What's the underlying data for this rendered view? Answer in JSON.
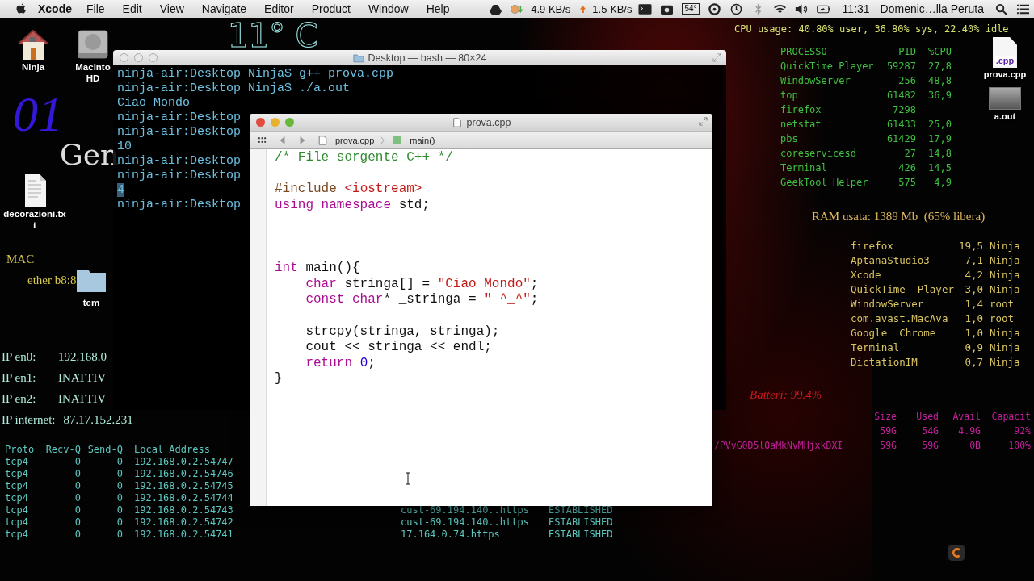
{
  "menu_bar": {
    "app": "Xcode",
    "menus": [
      "File",
      "Edit",
      "View",
      "Navigate",
      "Editor",
      "Product",
      "Window",
      "Help"
    ],
    "net_down": "4.9 KB/s",
    "net_up": "1.5 KB/s",
    "temperature": "54°",
    "clock": "11:31",
    "user": "Domenic…lla Peruta"
  },
  "clock_widget": {
    "temperature": "11° C",
    "day": "01",
    "month": "Gen"
  },
  "desktop_icons": [
    {
      "kind": "home",
      "label": "Ninja"
    },
    {
      "kind": "drive",
      "label": "Macinto HD"
    },
    {
      "kind": "text-file",
      "label": "decorazioni.txt"
    },
    {
      "kind": "folder",
      "label": "tem"
    }
  ],
  "desktop_files": [
    {
      "kind": "source-file",
      "badge": ".cpp",
      "label": "prova.cpp"
    },
    {
      "kind": "executable",
      "label": "a.out"
    }
  ],
  "mac_widget": {
    "title": "MAC",
    "ether": "ether b8:8"
  },
  "ip_widget": [
    {
      "label": "IP en0:",
      "value": "192.168.0"
    },
    {
      "label": "IP en1:",
      "value": "INATTIV"
    },
    {
      "label": "IP en2:",
      "value": "INATTIV"
    },
    {
      "label": "IP internet:",
      "value": "87.17.152.231"
    }
  ],
  "netstat": {
    "columns": [
      "Proto",
      "Recv-Q",
      "Send-Q",
      "Local Address"
    ],
    "rows": [
      {
        "proto": "tcp4",
        "recv": "0",
        "send": "0",
        "local": "192.168.0.2.54747"
      },
      {
        "proto": "tcp4",
        "recv": "0",
        "send": "0",
        "local": "192.168.0.2.54746"
      },
      {
        "proto": "tcp4",
        "recv": "0",
        "send": "0",
        "local": "192.168.0.2.54745"
      },
      {
        "proto": "tcp4",
        "recv": "0",
        "send": "0",
        "local": "192.168.0.2.54744"
      },
      {
        "proto": "tcp4",
        "recv": "0",
        "send": "0",
        "local": "192.168.0.2.54743",
        "foreign": "cust-69.194.140..https",
        "state": "ESTABLISHED"
      },
      {
        "proto": "tcp4",
        "recv": "0",
        "send": "0",
        "local": "192.168.0.2.54742",
        "foreign": "cust-69.194.140..https",
        "state": "ESTABLISHED"
      },
      {
        "proto": "tcp4",
        "recv": "0",
        "send": "0",
        "local": "192.168.0.2.54741",
        "foreign": "17.164.0.74.https",
        "state": "ESTABLISHED"
      }
    ]
  },
  "cpu_widget": {
    "summary": "CPU usage: 40.80% user, 36.80% sys, 22.40% idle",
    "columns": [
      "PROCESSO",
      "PID",
      "%CPU"
    ],
    "rows": [
      {
        "name": "QuickTime Player",
        "pid": "59287",
        "cpu": "27,8"
      },
      {
        "name": "WindowServer",
        "pid": "256",
        "cpu": "48,8"
      },
      {
        "name": "top",
        "pid": "61482",
        "cpu": "36,9"
      },
      {
        "name": "firefox",
        "pid": "7298"
      },
      {
        "name": "netstat",
        "pid": "61433",
        "cpu": "25,0"
      },
      {
        "name": "pbs",
        "pid": "61429",
        "cpu": "17,9"
      },
      {
        "name": "coreservicesd",
        "pid": "27",
        "cpu": "14,8"
      },
      {
        "name": "Terminal",
        "pid": "426",
        "cpu": "14,5"
      },
      {
        "name": "GeekTool Helper",
        "pid": "575",
        "cpu": "4,9"
      }
    ]
  },
  "ram_widget": {
    "summary": "RAM usata: 1389 Mb  (65% libera)",
    "rows": [
      {
        "name": "firefox",
        "mem": "19,5",
        "user": "Ninja"
      },
      {
        "name": "AptanaStudio3",
        "mem": "7,1",
        "user": "Ninja"
      },
      {
        "name": "Xcode",
        "mem": "4,2",
        "user": "Ninja"
      },
      {
        "name": "QuickTime  Player",
        "mem": "3,0",
        "user": "Ninja"
      },
      {
        "name": "WindowServer",
        "mem": "1,4",
        "user": "root"
      },
      {
        "name": "com.avast.MacAva",
        "mem": "1,0",
        "user": "root"
      },
      {
        "name": "Google  Chrome",
        "mem": "1,0",
        "user": "Ninja"
      },
      {
        "name": "Terminal",
        "mem": "0,9",
        "user": "Ninja"
      },
      {
        "name": "DictationIM",
        "mem": "0,7",
        "user": "Ninja"
      }
    ]
  },
  "battery_widget": {
    "text": "Batteri: 99.4%"
  },
  "disk_widget": {
    "columns": [
      "Size",
      "Used",
      "Avail",
      "Capacit"
    ],
    "rows": [
      {
        "values": [
          "59G",
          "54G",
          "4.9G",
          "92%"
        ]
      },
      {
        "name": "/PVvG0D5lOaMkNvMHjxkDXI",
        "values": [
          "59G",
          "59G",
          "0B",
          "100%"
        ]
      }
    ]
  },
  "terminal": {
    "title": "Desktop — bash — 80×24",
    "lines": [
      {
        "text": "ninja-air:Desktop Ninja$ g++ prova.cpp",
        "selected": false
      },
      {
        "text": "ninja-air:Desktop Ninja$ ./a.out",
        "selected": false
      },
      {
        "text": "Ciao Mondo",
        "selected": false
      },
      {
        "text": "ninja-air:Desktop",
        "selected": false
      },
      {
        "text": "ninja-air:Desktop",
        "selected": false
      },
      {
        "text": "10",
        "selected": false
      },
      {
        "text": "ninja-air:Desktop",
        "selected": false
      },
      {
        "text": "ninja-air:Desktop",
        "selected": false
      },
      {
        "text": "4",
        "selected": true
      },
      {
        "text": "ninja-air:Desktop",
        "selected": false
      }
    ]
  },
  "editor": {
    "title": "prova.cpp",
    "breadcrumb": [
      "prova.cpp",
      "main()"
    ],
    "lines": [
      {
        "kind": "code",
        "tokens": [
          {
            "text": "/* File sorgente C++ */",
            "kind": "comment"
          }
        ]
      },
      {
        "kind": "blank"
      },
      {
        "kind": "code",
        "tokens": [
          {
            "text": "#include ",
            "kind": "preproc"
          },
          {
            "text": "<iostream>",
            "kind": "string"
          }
        ]
      },
      {
        "kind": "code",
        "tokens": [
          {
            "text": "using namespace",
            "kind": "keyword"
          },
          {
            "text": " std;",
            "kind": "plain"
          }
        ]
      },
      {
        "kind": "blank"
      },
      {
        "kind": "blank"
      },
      {
        "kind": "blank"
      },
      {
        "kind": "code",
        "tokens": [
          {
            "text": "int",
            "kind": "keyword"
          },
          {
            "text": " main(){",
            "kind": "plain"
          }
        ]
      },
      {
        "kind": "code",
        "tokens": [
          {
            "text": "    char",
            "kind": "keyword"
          },
          {
            "text": " stringa[] = ",
            "kind": "plain"
          },
          {
            "text": "\"Ciao Mondo\"",
            "kind": "string"
          },
          {
            "text": ";",
            "kind": "plain"
          }
        ]
      },
      {
        "kind": "code",
        "tokens": [
          {
            "text": "    const char",
            "kind": "keyword"
          },
          {
            "text": "* _stringa = ",
            "kind": "plain"
          },
          {
            "text": "\" ^_^\"",
            "kind": "string"
          },
          {
            "text": ";",
            "kind": "plain"
          }
        ]
      },
      {
        "kind": "blank"
      },
      {
        "kind": "code",
        "tokens": [
          {
            "text": "    strcpy(stringa,_stringa);",
            "kind": "plain"
          }
        ]
      },
      {
        "kind": "code",
        "tokens": [
          {
            "text": "    cout << stringa << endl;",
            "kind": "plain"
          }
        ]
      },
      {
        "kind": "code",
        "tokens": [
          {
            "text": "    return ",
            "kind": "keyword"
          },
          {
            "text": "0",
            "kind": "number"
          },
          {
            "text": ";",
            "kind": "plain"
          }
        ]
      },
      {
        "kind": "code",
        "tokens": [
          {
            "text": "}",
            "kind": "plain"
          }
        ]
      }
    ]
  }
}
